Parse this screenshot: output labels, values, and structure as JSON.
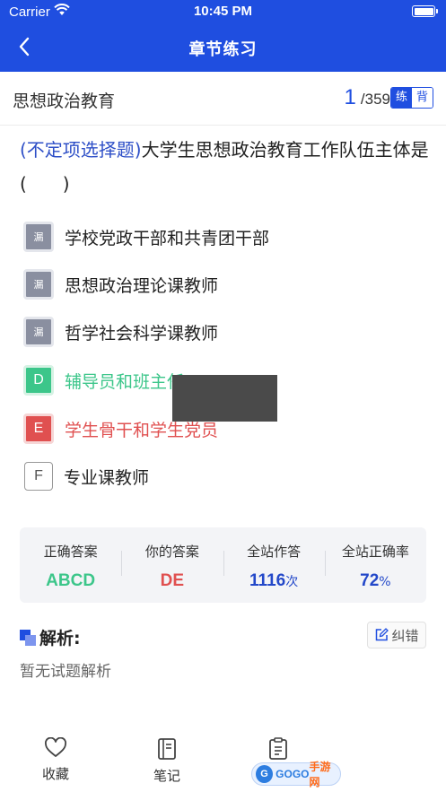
{
  "status_bar": {
    "carrier": "Carrier",
    "time": "10:45 PM"
  },
  "header": {
    "title": "章节练习"
  },
  "subject": {
    "name": "思想政治教育",
    "current": "1",
    "total": "/359",
    "mode_on": "练",
    "mode_off": "背"
  },
  "question": {
    "type": "(不定项选择题)",
    "text": "大学生思想政治教育工作队伍主体是(　　)"
  },
  "options": [
    {
      "badge": "漏",
      "text": "学校党政干部和共青团干部",
      "state": "missed"
    },
    {
      "badge": "漏",
      "text": "思想政治理论课教师",
      "state": "missed"
    },
    {
      "badge": "漏",
      "text": "哲学社会科学课教师",
      "state": "missed"
    },
    {
      "badge": "D",
      "text": "辅导员和班主任",
      "state": "correct"
    },
    {
      "badge": "E",
      "text": "学生骨干和学生党员",
      "state": "wrong"
    },
    {
      "badge": "F",
      "text": "专业课教师",
      "state": "plain"
    }
  ],
  "stats": {
    "correct_label": "正确答案",
    "correct_value": "ABCD",
    "yours_label": "你的答案",
    "yours_value": "DE",
    "attempts_label": "全站作答",
    "attempts_value": "1116",
    "attempts_unit": "次",
    "rate_label": "全站正确率",
    "rate_value": "72",
    "rate_unit": "%"
  },
  "analysis": {
    "title": "解析:",
    "report_label": "纠错",
    "body": "暂无试题解析"
  },
  "tabbar": {
    "favorite_label": "收藏",
    "notes_label": "笔记"
  },
  "watermark": {
    "brand_a": "GOGO",
    "brand_b": "手游网"
  },
  "colors": {
    "primary": "#1f4ee0",
    "correct": "#3cc68a",
    "wrong": "#e05050",
    "missed": "#8a8fa0"
  }
}
